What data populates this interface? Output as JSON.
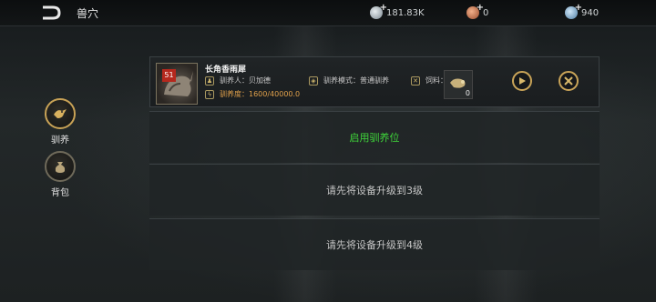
{
  "header": {
    "title": "兽穴"
  },
  "resources": {
    "silver": "181.83K",
    "copper": "0",
    "gem": "940"
  },
  "sidebar": {
    "items": [
      {
        "label": "驯养",
        "icon": "bird-icon"
      },
      {
        "label": "背包",
        "icon": "bag-icon"
      }
    ]
  },
  "slot": {
    "level": "51",
    "beast_name": "长角香雨犀",
    "trainer": "驯养人：贝加德",
    "mode": "驯养模式：普通驯养",
    "feed_label": "饲料：",
    "feed_qty": "0",
    "taming": "驯养度：1600/40000.0"
  },
  "rows": {
    "open_slot": "启用驯养位",
    "lock3": "请先将设备升级到3级",
    "lock4": "请先将设备升级到4级"
  },
  "colors": {
    "accent_gold": "#c9a458",
    "open_green": "#3fd63a",
    "level_red": "#b5281d"
  }
}
